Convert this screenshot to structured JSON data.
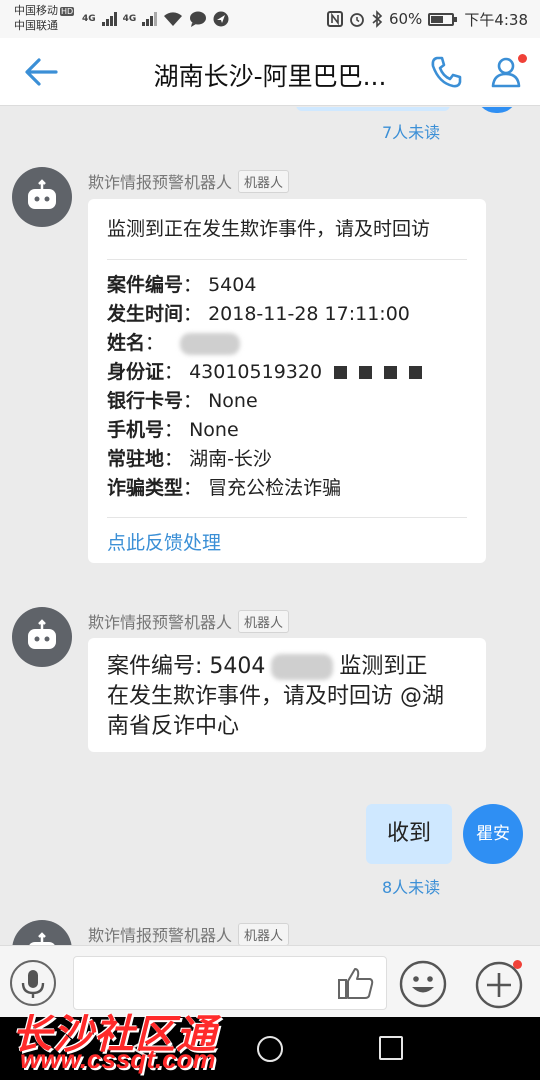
{
  "status_bar": {
    "carrier1": "中国移动",
    "carrier2": "中国联通",
    "hd_badge": "HD",
    "net1": "4G",
    "net2": "4G",
    "battery_text": "60%",
    "battery_level": 0.6,
    "time": "下午4:38"
  },
  "header": {
    "title": "湖南长沙-阿里巴巴..."
  },
  "chat": {
    "prev_unread": "7人未读",
    "messages": [
      {
        "sender": "欺诈情报预警机器人",
        "tag": "机器人",
        "card_title": "监测到正在发生欺诈事件，请及时回访",
        "fields": [
          {
            "label": "案件编号",
            "sep": "：",
            "value": "5404"
          },
          {
            "label": "发生时间",
            "sep": "：",
            "value": "2018-11-28 17:11:00"
          },
          {
            "label": "姓名",
            "sep": "：",
            "value": ""
          },
          {
            "label": "身份证",
            "sep": "：",
            "value": "43010519320"
          },
          {
            "label": "银行卡号",
            "sep": "：",
            "value": "None"
          },
          {
            "label": "手机号",
            "sep": "：",
            "value": "None"
          },
          {
            "label": "常驻地",
            "sep": "：",
            "value": "湖南-长沙"
          },
          {
            "label": "诈骗类型",
            "sep": "：",
            "value": "冒充公检法诈骗"
          }
        ],
        "action_link": "点此反馈处理"
      },
      {
        "sender": "欺诈情报预警机器人",
        "tag": "机器人",
        "text_prefix": "案件编号: 5404",
        "text_suffix": "监测到正在发生欺诈事件，请及时回访 @湖南省反诈中心"
      },
      {
        "outgoing_text": "收到",
        "user_avatar_name": "瞿安",
        "unread": "8人未读"
      },
      {
        "sender": "欺诈情报预警机器人",
        "tag": "机器人"
      }
    ]
  },
  "watermark": {
    "site_name": "长沙社区通",
    "site_url": "www.cssqt.com"
  },
  "colors": {
    "accent_blue": "#3b8fd6",
    "bubble_blue": "#cfe8ff",
    "avatar_blue": "#2f8ff3",
    "badge_red": "#f04138",
    "watermark_red": "#ff2a2a"
  },
  "icons": {
    "back": "arrow-left-icon",
    "call": "phone-icon",
    "members": "person-icon",
    "voice": "microphone-icon",
    "like": "thumbs-up-icon",
    "emoji": "smiley-icon",
    "more": "plus-icon"
  }
}
